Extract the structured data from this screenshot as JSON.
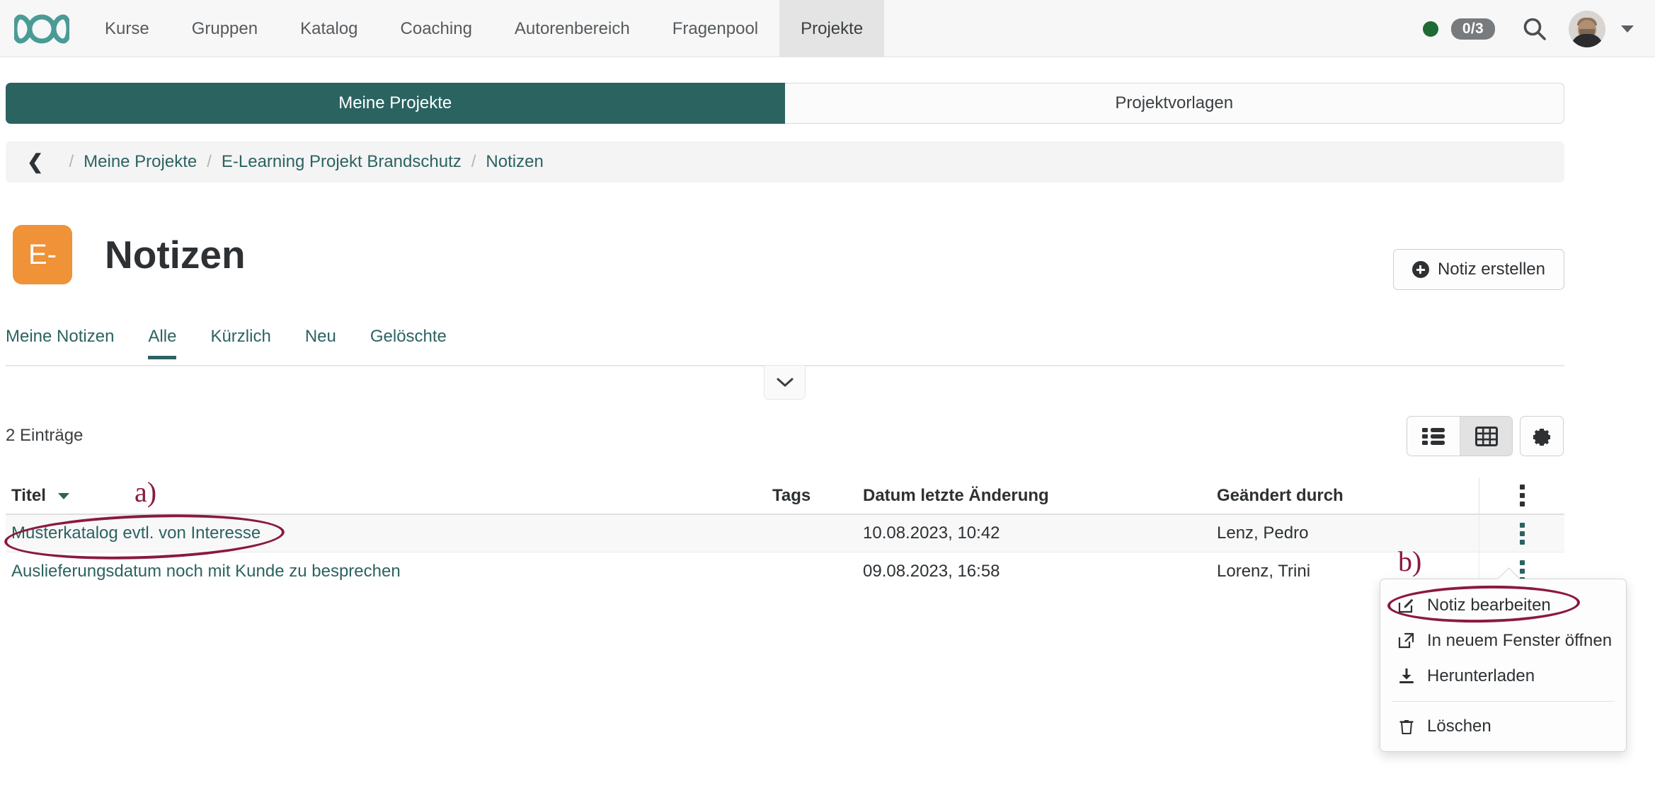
{
  "topnav": {
    "logo": "infinity-logo",
    "items": [
      {
        "label": "Kurse",
        "active": false
      },
      {
        "label": "Gruppen",
        "active": false
      },
      {
        "label": "Katalog",
        "active": false
      },
      {
        "label": "Coaching",
        "active": false
      },
      {
        "label": "Autorenbereich",
        "active": false
      },
      {
        "label": "Fragenpool",
        "active": false
      },
      {
        "label": "Projekte",
        "active": true
      }
    ],
    "status_dot_color": "#1f6a35",
    "count_badge": "0/3",
    "search_icon": "search-icon",
    "avatar_icon": "user-avatar",
    "user_caret": "chevron-down-icon"
  },
  "segmented_tabs": [
    {
      "label": "Meine Projekte",
      "active": true
    },
    {
      "label": "Projektvorlagen",
      "active": false
    }
  ],
  "breadcrumb": {
    "back_icon": "chevron-left-icon",
    "separator": "/",
    "items": [
      "Meine Projekte",
      "E-Learning Projekt Brandschutz",
      "Notizen"
    ]
  },
  "header": {
    "icon_text": "E-",
    "icon_color": "#ef9238",
    "title": "Notizen",
    "create_button": "Notiz erstellen"
  },
  "subtabs": [
    {
      "label": "Meine Notizen",
      "active": false
    },
    {
      "label": "Alle",
      "active": true
    },
    {
      "label": "Kürzlich",
      "active": false
    },
    {
      "label": "Neu",
      "active": false
    },
    {
      "label": "Gelöschte",
      "active": false
    }
  ],
  "toolbar": {
    "collapse_icon": "chevron-down-icon",
    "result_count": "2 Einträge",
    "view_list_icon": "list-view-icon",
    "view_table_icon": "table-view-icon",
    "settings_icon": "gear-icon",
    "active_view": "table"
  },
  "table": {
    "columns": [
      "Titel",
      "Tags",
      "Datum letzte Änderung",
      "Geändert durch"
    ],
    "sort_column": "Titel",
    "sort_icon": "caret-down-icon",
    "header_menu_icon": "kebab-menu-icon",
    "rows": [
      {
        "title": "Musterkatalog evtl. von Interesse",
        "tags": "",
        "modified": "10.08.2023, 10:42",
        "modified_by": "Lenz, Pedro",
        "menu_icon": "kebab-menu-icon"
      },
      {
        "title": "Auslieferungsdatum noch mit Kunde zu besprechen",
        "tags": "",
        "modified": "09.08.2023, 16:58",
        "modified_by": "Lorenz, Trini",
        "menu_icon": "kebab-menu-icon"
      }
    ]
  },
  "context_menu": {
    "items": [
      {
        "label": "Notiz bearbeiten",
        "icon": "edit-pencil-icon"
      },
      {
        "label": "In neuem Fenster öffnen",
        "icon": "external-link-icon"
      },
      {
        "label": "Herunterladen",
        "icon": "download-icon"
      },
      {
        "label": "Löschen",
        "icon": "trash-icon"
      }
    ]
  },
  "annotations": {
    "color": "#8a1a3f",
    "markers": [
      {
        "label": "a)",
        "target": "row-1-title-link"
      },
      {
        "label": "b)",
        "target": "context-menu-edit-item"
      }
    ]
  }
}
